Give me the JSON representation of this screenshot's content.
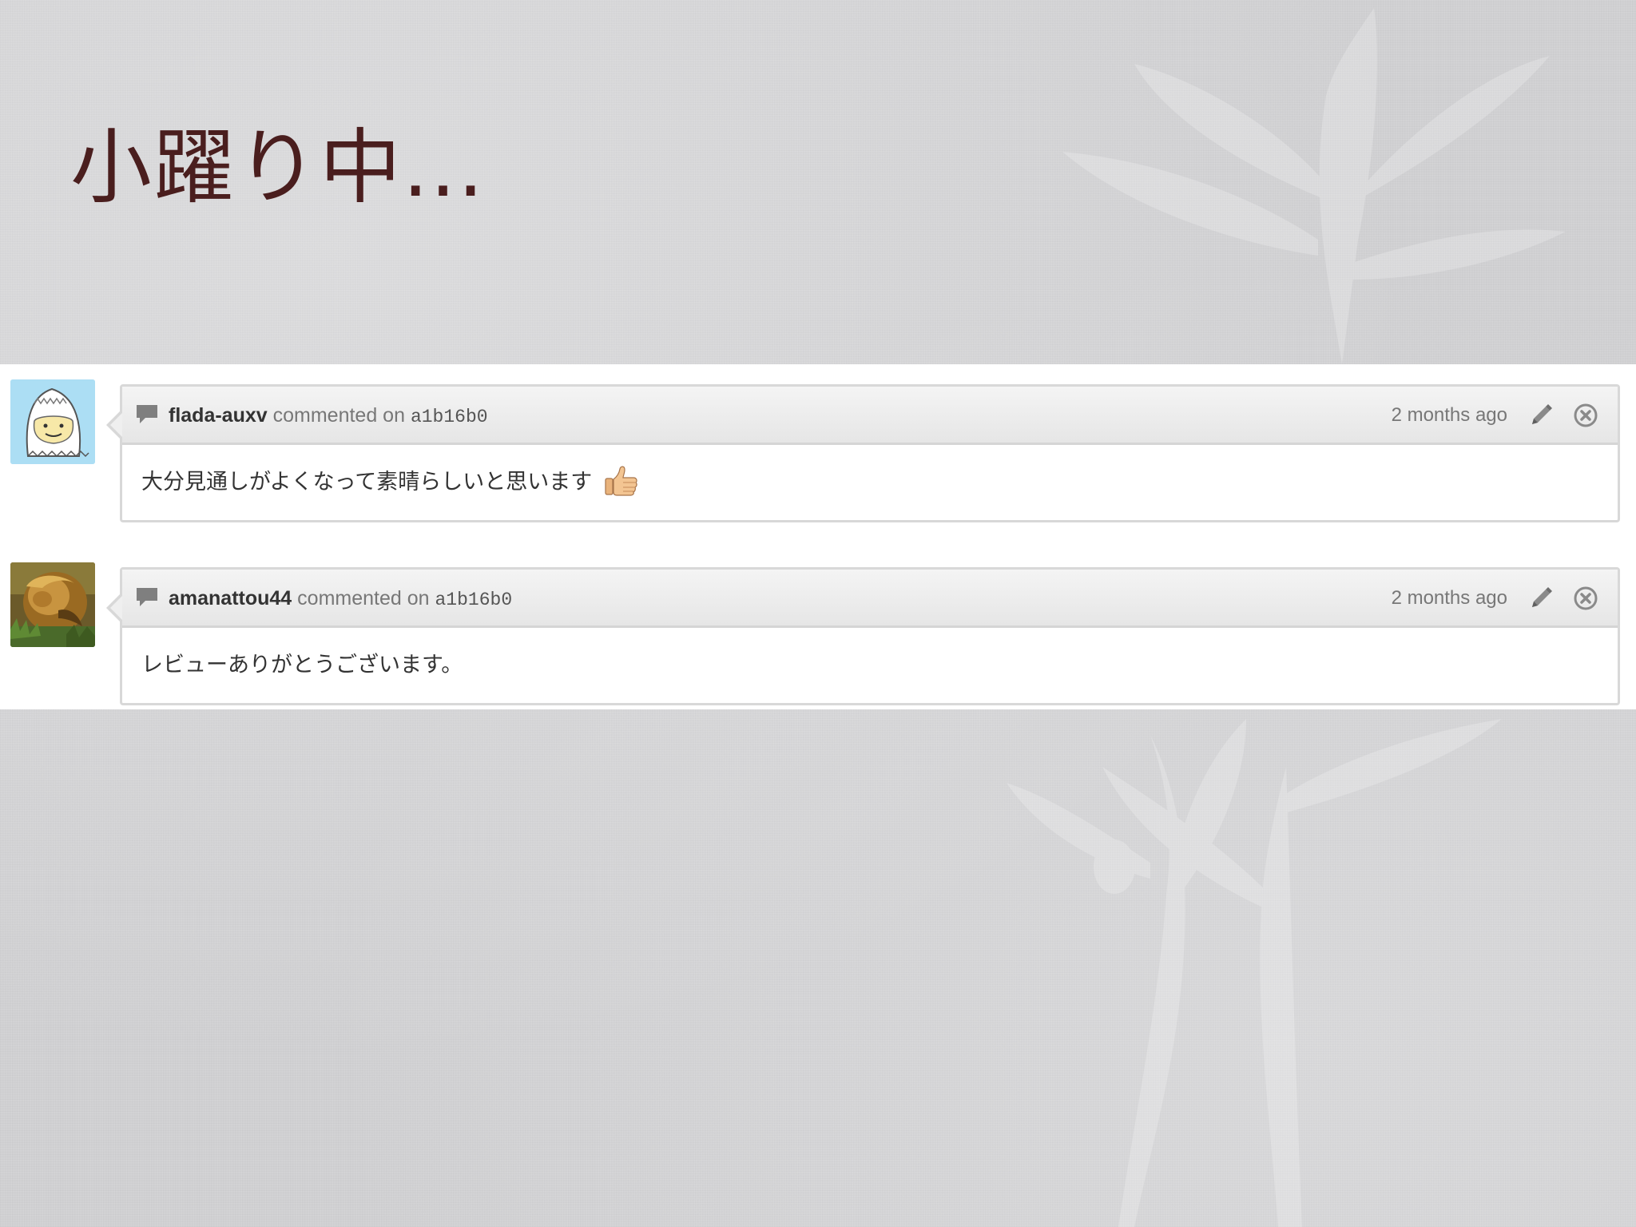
{
  "slide": {
    "title": "小躍り中..."
  },
  "comments": [
    {
      "author": "flada-auxv",
      "action": "commented on",
      "commit": "a1b16b0",
      "time": "2 months ago",
      "body": "大分見通しがよくなって素晴らしいと思います",
      "emoji": "thumbs-up-icon"
    },
    {
      "author": "amanattou44",
      "action": "commented on",
      "commit": "a1b16b0",
      "time": "2 months ago",
      "body": "レビューありがとうございます。"
    }
  ],
  "colors": {
    "title": "#4a1e1e",
    "background": "#d3d3d5",
    "panel": "#ffffff",
    "header": "#ececec",
    "border": "#d8d8d8"
  }
}
